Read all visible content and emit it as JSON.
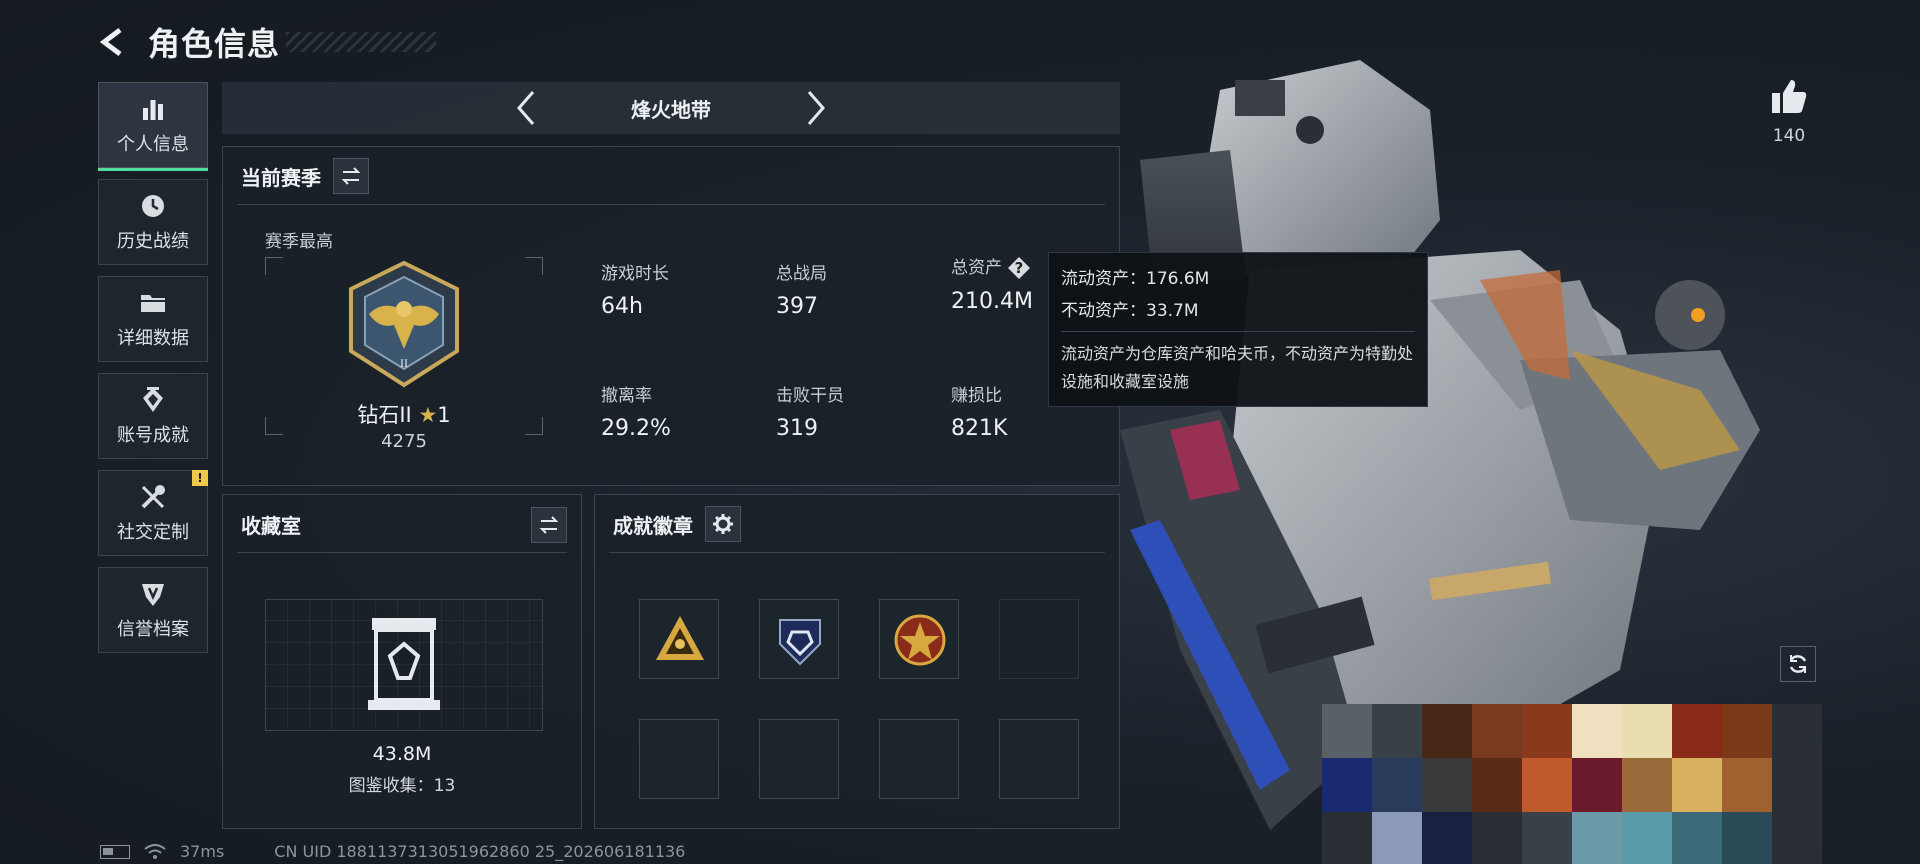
{
  "header": {
    "title": "角色信息"
  },
  "sidebar": {
    "items": [
      {
        "label": "个人信息",
        "icon": "bar-chart-icon",
        "active": true
      },
      {
        "label": "历史战绩",
        "icon": "clock-history-icon"
      },
      {
        "label": "详细数据",
        "icon": "folder-icon"
      },
      {
        "label": "账号成就",
        "icon": "achievement-icon"
      },
      {
        "label": "社交定制",
        "icon": "tools-icon",
        "badge": "!"
      },
      {
        "label": "信誉档案",
        "icon": "shield-icon"
      }
    ]
  },
  "mode": {
    "title": "烽火地带"
  },
  "season": {
    "title": "当前赛季",
    "best_label": "赛季最高",
    "rank": {
      "name": "钻石II",
      "star": "★",
      "stars": "1",
      "score": "4275"
    },
    "stats": [
      {
        "label": "游戏时长",
        "value": "64h"
      },
      {
        "label": "总战局",
        "value": "397"
      },
      {
        "label": "总资产",
        "value": "210.4M",
        "help": "?"
      },
      {
        "label": "撤离率",
        "value": "29.2%"
      },
      {
        "label": "击败干员",
        "value": "319"
      },
      {
        "label": "赚损比",
        "value": "821K"
      }
    ]
  },
  "tooltip": {
    "liquid": "流动资产：176.6M",
    "fixed": "不动资产：33.7M",
    "desc": "流动资产为仓库资产和哈夫币，不动资产为特勤处设施和收藏室设施"
  },
  "collection": {
    "title": "收藏室",
    "value": "43.8M",
    "count_label": "图鉴收集：13"
  },
  "badges": {
    "title": "成就徽章"
  },
  "likes": {
    "count": "140"
  },
  "status": {
    "ping": "37ms",
    "uid": "CN UID 1881137313051962860 25_202606181136"
  },
  "colors": {
    "accent": "#4fdb9a",
    "gold": "#d8b24a",
    "background": "#161c22"
  }
}
